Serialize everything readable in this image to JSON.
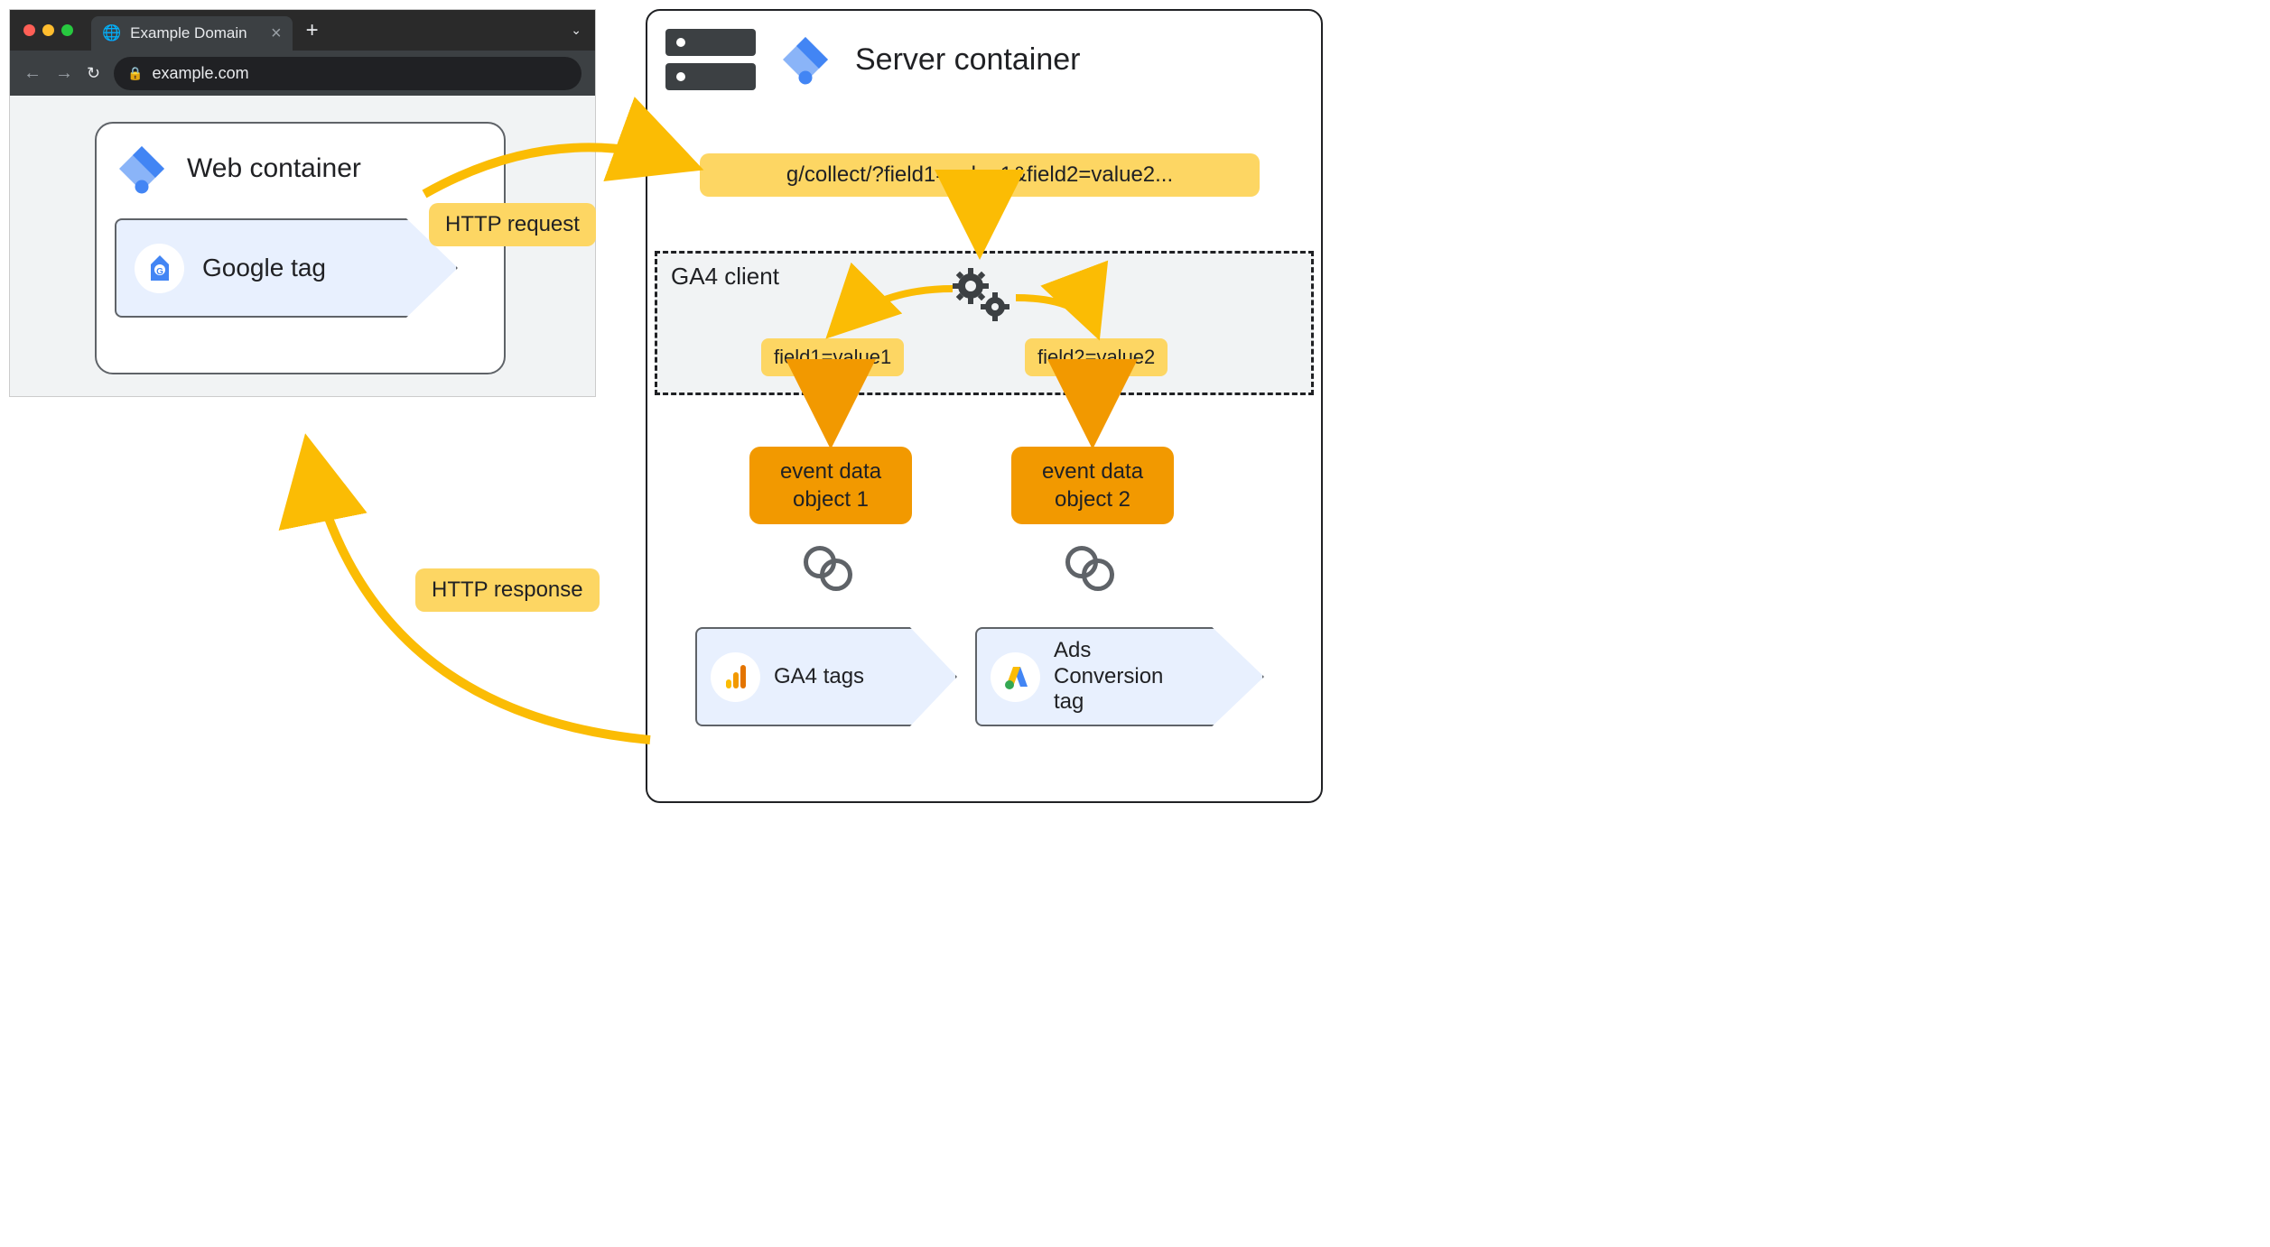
{
  "browser": {
    "tab_title": "Example Domain",
    "url": "example.com"
  },
  "web_container": {
    "title": "Web container",
    "google_tag_label": "Google tag"
  },
  "server_container": {
    "title": "Server container",
    "collect_url": "g/collect/?field1=value1&field2=value2...",
    "ga4_client_label": "GA4 client",
    "field1": "field1=value1",
    "field2": "field2=value2",
    "event1": "event data\nobject 1",
    "event2": "event data\nobject 2",
    "ga4_tags_label": "GA4 tags",
    "ads_tags_label": "Ads\nConversion\ntag"
  },
  "flow": {
    "http_request": "HTTP request",
    "http_response": "HTTP response"
  }
}
